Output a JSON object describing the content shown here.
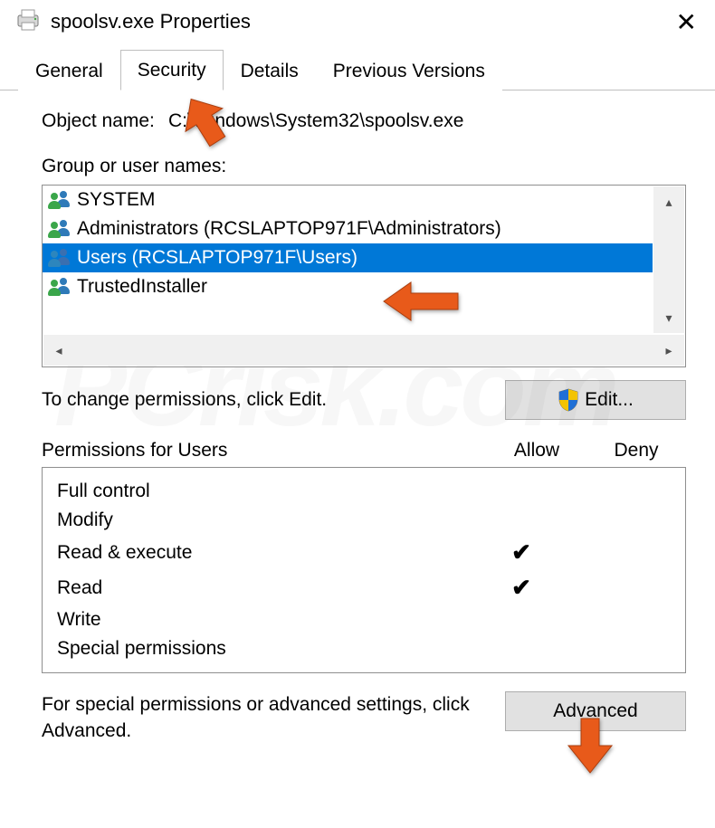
{
  "titlebar": {
    "title": "spoolsv.exe Properties"
  },
  "tabs": [
    {
      "label": "General"
    },
    {
      "label": "Security"
    },
    {
      "label": "Details"
    },
    {
      "label": "Previous Versions"
    }
  ],
  "active_tab_index": 1,
  "object": {
    "label": "Object name:",
    "value": "C:\\Windows\\System32\\spoolsv.exe"
  },
  "groups": {
    "label": "Group or user names:",
    "items": [
      {
        "name": "SYSTEM",
        "selected": false
      },
      {
        "name": "Administrators (RCSLAPTOP971F\\Administrators)",
        "selected": false
      },
      {
        "name": "Users (RCSLAPTOP971F\\Users)",
        "selected": true
      },
      {
        "name": "TrustedInstaller",
        "selected": false
      }
    ]
  },
  "change_text": "To change permissions, click Edit.",
  "edit_button": "Edit...",
  "permissions": {
    "header": {
      "title": "Permissions for Users",
      "allow": "Allow",
      "deny": "Deny"
    },
    "rows": [
      {
        "name": "Full control",
        "allow": false,
        "deny": false
      },
      {
        "name": "Modify",
        "allow": false,
        "deny": false
      },
      {
        "name": "Read & execute",
        "allow": true,
        "deny": false
      },
      {
        "name": "Read",
        "allow": true,
        "deny": false
      },
      {
        "name": "Write",
        "allow": false,
        "deny": false
      },
      {
        "name": "Special permissions",
        "allow": false,
        "deny": false
      }
    ]
  },
  "advanced_text": "For special permissions or advanced settings, click Advanced.",
  "advanced_button": "Advanced",
  "colors": {
    "selection": "#0078d7",
    "annotation": "#e85a1a"
  }
}
